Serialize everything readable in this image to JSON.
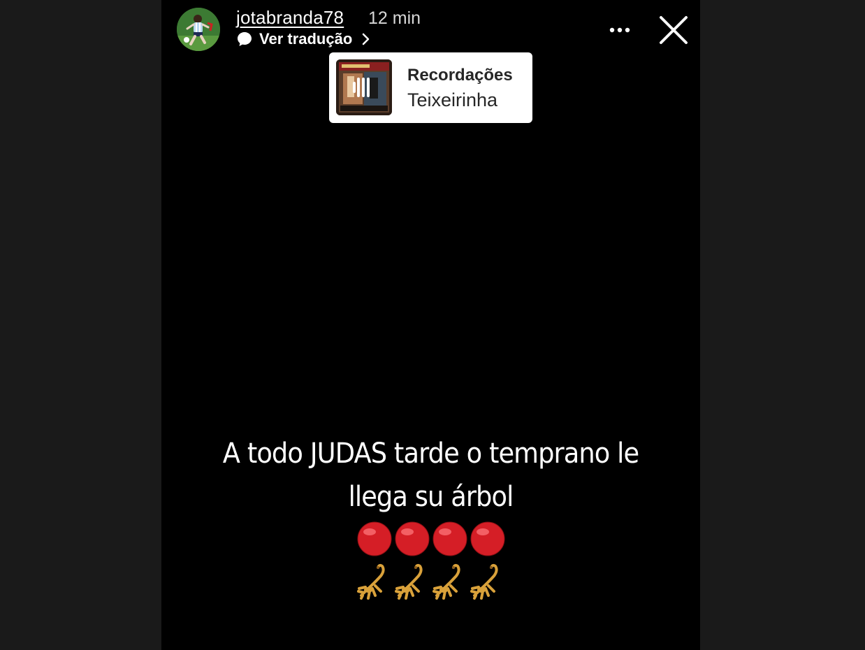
{
  "header": {
    "username": "jotabranda78",
    "time_ago": "12 min",
    "translate_label": "Ver tradução"
  },
  "music_sticker": {
    "title": "Recordações",
    "artist": "Teixeirinha"
  },
  "caption": {
    "line1": "A  todo JUDAS tarde o temprano le",
    "line2": "llega su árbol"
  },
  "emojis": {
    "circles": [
      "red-circle",
      "red-circle",
      "red-circle",
      "red-circle"
    ],
    "scorpions": [
      "scorpion",
      "scorpion",
      "scorpion",
      "scorpion"
    ]
  },
  "colors": {
    "story_background": "#000000",
    "outer_background": "#1a1a1a",
    "sticker_background": "#ffffff",
    "red_circle": "#e0242c",
    "scorpion": "#d9a13a"
  }
}
